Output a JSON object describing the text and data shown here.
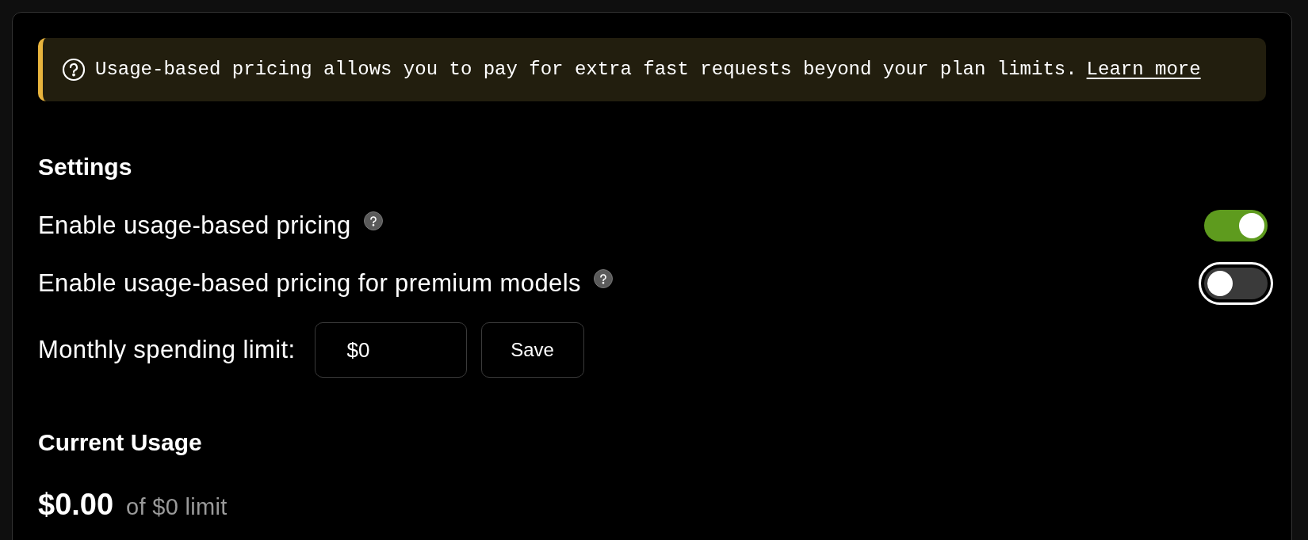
{
  "banner": {
    "text": "Usage-based pricing allows you to pay for extra fast requests beyond your plan limits.",
    "link": "Learn more"
  },
  "settings": {
    "title": "Settings",
    "toggles": [
      {
        "label": "Enable usage-based pricing",
        "on": true,
        "focused": false
      },
      {
        "label": "Enable usage-based pricing for premium models",
        "on": false,
        "focused": true
      }
    ],
    "limit": {
      "label": "Monthly spending limit:",
      "value": "$0",
      "button": "Save"
    }
  },
  "usage": {
    "title": "Current Usage",
    "amount": "$0.00",
    "of_limit": "of $0 limit"
  }
}
